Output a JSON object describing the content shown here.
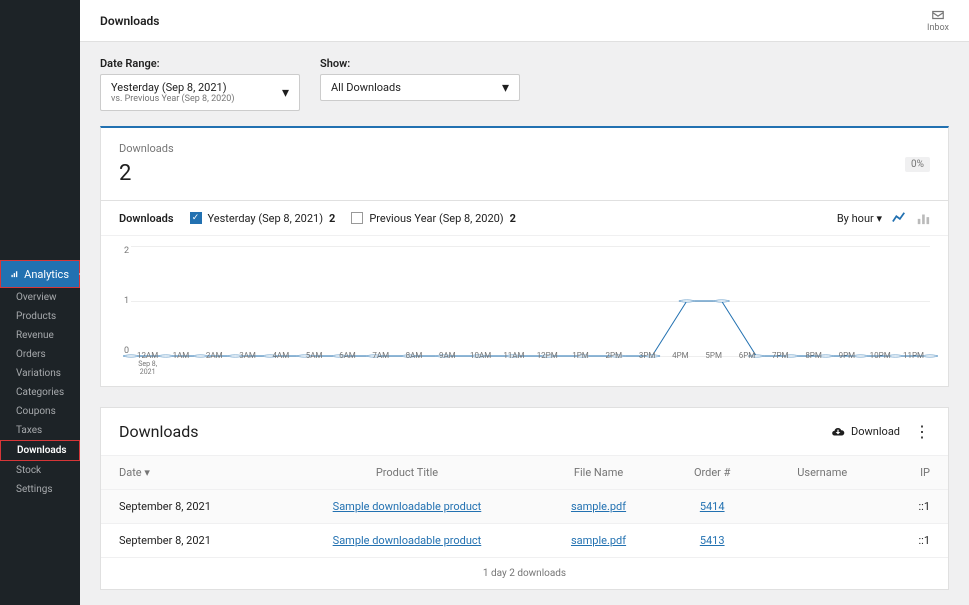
{
  "header": {
    "title": "Downloads",
    "inbox": "Inbox"
  },
  "sidebar": {
    "main": "Analytics",
    "items": [
      "Overview",
      "Products",
      "Revenue",
      "Orders",
      "Variations",
      "Categories",
      "Coupons",
      "Taxes",
      "Downloads",
      "Stock",
      "Settings"
    ],
    "active": "Downloads"
  },
  "controls": {
    "date_range_label": "Date Range:",
    "date_range_value": "Yesterday (Sep 8, 2021)",
    "date_range_sub": "vs. Previous Year (Sep 8, 2020)",
    "show_label": "Show:",
    "show_value": "All Downloads"
  },
  "summary": {
    "title": "Downloads",
    "value": "2",
    "badge": "0%"
  },
  "legend": {
    "title": "Downloads",
    "s1_label": "Yesterday (Sep 8, 2021)",
    "s1_val": "2",
    "s2_label": "Previous Year (Sep 8, 2020)",
    "s2_val": "2",
    "interval": "By hour"
  },
  "x_ticks": [
    "12AM",
    "1AM",
    "2AM",
    "3AM",
    "4AM",
    "5AM",
    "6AM",
    "7AM",
    "8AM",
    "9AM",
    "10AM",
    "11AM",
    "12PM",
    "1PM",
    "2PM",
    "3PM",
    "4PM",
    "5PM",
    "6PM",
    "7PM",
    "8PM",
    "9PM",
    "10PM",
    "11PM"
  ],
  "x_sub": "Sep 8, 2021",
  "y_ticks": [
    "2",
    "1",
    "0"
  ],
  "chart_data": {
    "type": "line",
    "categories": [
      "12AM",
      "1AM",
      "2AM",
      "3AM",
      "4AM",
      "5AM",
      "6AM",
      "7AM",
      "8AM",
      "9AM",
      "10AM",
      "11AM",
      "12PM",
      "1PM",
      "2PM",
      "3PM",
      "4PM",
      "5PM",
      "6PM",
      "7PM",
      "8PM",
      "9PM",
      "10PM",
      "11PM"
    ],
    "series": [
      {
        "name": "Yesterday (Sep 8, 2021)",
        "values": [
          0,
          0,
          0,
          0,
          0,
          0,
          0,
          0,
          0,
          0,
          0,
          0,
          0,
          0,
          0,
          0,
          1,
          1,
          0,
          0,
          0,
          0,
          0,
          0
        ]
      },
      {
        "name": "Previous Year (Sep 8, 2020)",
        "values": [
          0,
          0,
          0,
          0,
          0,
          0,
          0,
          0,
          0,
          0,
          0,
          0,
          0,
          0,
          0,
          0,
          0,
          0,
          0,
          0,
          0,
          0,
          0,
          0
        ]
      }
    ],
    "ylim": [
      0,
      2
    ],
    "ylabel": "",
    "xlabel": ""
  },
  "table": {
    "title": "Downloads",
    "download_btn": "Download",
    "cols": {
      "date": "Date",
      "product": "Product Title",
      "file": "File Name",
      "order": "Order #",
      "user": "Username",
      "ip": "IP"
    },
    "rows": [
      {
        "date": "September 8, 2021",
        "product": "Sample downloadable product",
        "file": "sample.pdf",
        "order": "5414",
        "user": "",
        "ip": "::1"
      },
      {
        "date": "September 8, 2021",
        "product": "Sample downloadable product",
        "file": "sample.pdf",
        "order": "5413",
        "user": "",
        "ip": "::1"
      }
    ],
    "summary": "1 day    2 downloads"
  }
}
